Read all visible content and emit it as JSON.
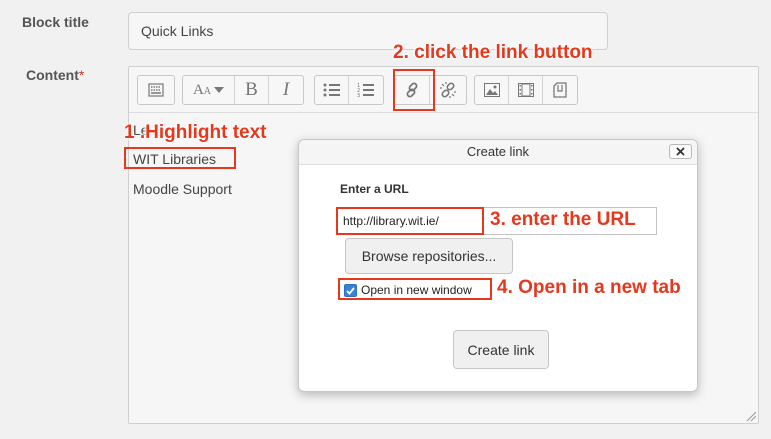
{
  "form": {
    "block_title_label": "Block title",
    "block_title_value": "Quick Links",
    "content_label": "Content",
    "required_marker": "*"
  },
  "editor": {
    "toolbar_groups": [
      [
        "toolbar-toggle-icon"
      ],
      [
        "font-style-icon",
        "bold-icon",
        "italic-icon"
      ],
      [
        "unordered-list-icon",
        "ordered-list-icon"
      ],
      [
        "link-icon",
        "unlink-icon"
      ],
      [
        "image-icon",
        "media-icon",
        "file-icon"
      ]
    ],
    "lines": [
      "Le",
      "WIT Libraries",
      "Moodle Support"
    ]
  },
  "dialog": {
    "title": "Create link",
    "url_label": "Enter a URL",
    "url_value": "http://library.wit.ie/",
    "browse_button": "Browse repositories...",
    "new_window_label": "Open in new window",
    "new_window_checked": true,
    "create_button": "Create link"
  },
  "annotations": {
    "step1": "1 .Highlight text",
    "step2": "2. click the link button",
    "step3": "3. enter the URL",
    "step4": "4. Open in a new tab",
    "color": "#e5381c"
  }
}
